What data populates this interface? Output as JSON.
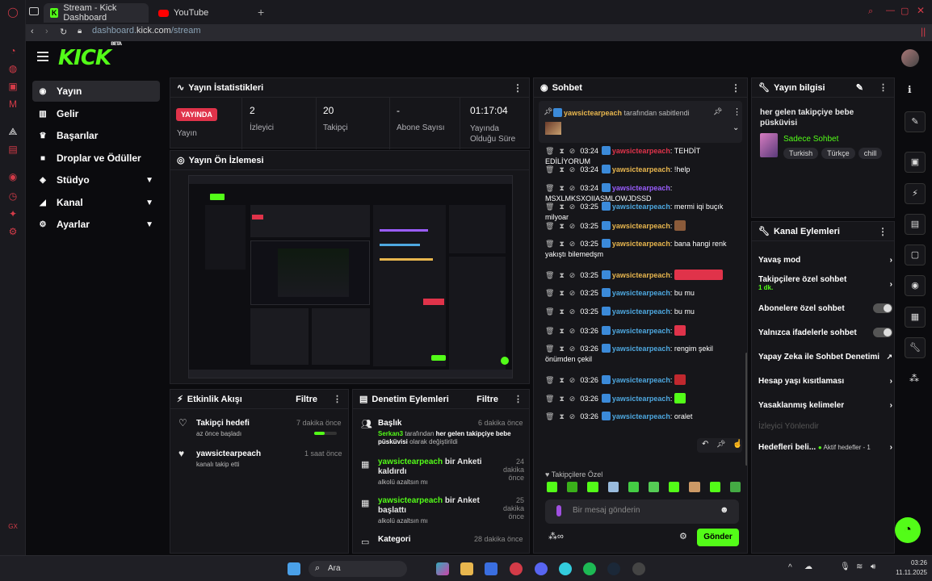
{
  "browser": {
    "tabs": [
      {
        "label": "Stream - Kick Dashboard"
      },
      {
        "label": "YouTube"
      }
    ],
    "address": {
      "prefix": "dashboard.",
      "domain": "kick.com",
      "path": "/stream"
    }
  },
  "header": {
    "logo": "KICK",
    "logo_badge": "BETA"
  },
  "sidebar": {
    "items": [
      {
        "label": "Yayın",
        "icon": "broadcast-icon",
        "active": true
      },
      {
        "label": "Gelir",
        "icon": "chart-icon"
      },
      {
        "label": "Başarılar",
        "icon": "trophy-icon"
      },
      {
        "label": "Droplar ve Ödüller",
        "icon": "gift-icon"
      },
      {
        "label": "Stüdyo",
        "icon": "studio-icon",
        "expandable": true
      },
      {
        "label": "Kanal",
        "icon": "speaker-icon",
        "expandable": true
      },
      {
        "label": "Ayarlar",
        "icon": "gear-icon",
        "expandable": true
      }
    ]
  },
  "stats": {
    "title": "Yayın İstatistikleri",
    "live_badge": "YAYINDA",
    "live_label": "Yayın",
    "items": [
      {
        "value": "2",
        "label": "İzleyici"
      },
      {
        "value": "20",
        "label": "Takipçi"
      },
      {
        "value": "-",
        "label": "Abone Sayısı"
      },
      {
        "value": "01:17:04",
        "label": "Yayında Olduğu Süre"
      }
    ]
  },
  "preview": {
    "title": "Yayın Ön İzlemesi"
  },
  "activity": {
    "title": "Etkinlik Akışı",
    "filter": "Filtre",
    "items": [
      {
        "title": "Takipçi hedefi",
        "sub": "az önce başladı",
        "time": "7 dakika önce",
        "progress": 0.45
      },
      {
        "title": "yawsictearpeach",
        "sub": "kanalı takip etti",
        "time": "1 saat önce"
      }
    ]
  },
  "moderation": {
    "title": "Denetim Eylemleri",
    "filter": "Filtre",
    "items": [
      {
        "title": "Başlık",
        "time": "6 dakika önce",
        "user": "Serkan3",
        "mid": " tarafından ",
        "highlight": "her gelen takipçiye bebe püsküvisi",
        "tail": " olarak değiştirildi"
      },
      {
        "title": "yawsictearpeach",
        "title2": " bir Anketi kaldırdı",
        "time": "24 dakika önce",
        "sub": "alkolü azaltsın mı"
      },
      {
        "title": "yawsictearpeach",
        "title2": " bir Anket başlattı",
        "time": "25 dakika önce",
        "sub": "alkolü azaltsın mı"
      },
      {
        "title": "Kategori",
        "time": "28 dakika önce"
      }
    ]
  },
  "chat": {
    "title": "Sohbet",
    "pinned_user": "yawsictearpeach",
    "pinned_text": " tarafından sabitlendi",
    "messages": [
      {
        "time": "03:24",
        "user": "yawsictearpeach",
        "color": "red",
        "text": ": TEHDİT EDİLİYORUM"
      },
      {
        "time": "03:24",
        "user": "yawsictearpeach",
        "color": "yellow",
        "text": ": !help"
      },
      {
        "time": "03:24",
        "user": "yawsictearpeach",
        "color": "purple",
        "text": ": MSXLMKSXOIIASMLOWJDSSD"
      },
      {
        "time": "03:25",
        "user": "yawsictearpeach",
        "color": "blue",
        "text": ": mermi iqi buçık milyoar"
      },
      {
        "time": "03:25",
        "user": "yawsictearpeach",
        "color": "yellow",
        "text": ":"
      },
      {
        "time": "03:25",
        "user": "yawsictearpeach",
        "color": "yellow",
        "text": ": bana hangi renk yakıştı bilemedşm"
      },
      {
        "time": "03:25",
        "user": "yawsictearpeach",
        "color": "yellow",
        "text": ":"
      },
      {
        "time": "03:25",
        "user": "yawsictearpeach",
        "color": "blue",
        "text": ": bu mu"
      },
      {
        "time": "03:25",
        "user": "yawsictearpeach",
        "color": "blue",
        "text": ": bu mu"
      },
      {
        "time": "03:26",
        "user": "yawsictearpeach",
        "color": "blue",
        "text": ":"
      },
      {
        "time": "03:26",
        "user": "yawsictearpeach",
        "color": "blue",
        "text": ": rengim şekil önümden çekil"
      },
      {
        "time": "03:26",
        "user": "yawsictearpeach",
        "color": "blue",
        "text": ":"
      },
      {
        "time": "03:26",
        "user": "yawsictearpeach",
        "color": "blue",
        "text": ":"
      },
      {
        "time": "03:26",
        "user": "yawsictearpeach",
        "color": "blue",
        "text": ": oralet"
      }
    ],
    "followers_only": "Takipçilere Özel",
    "input_placeholder": "Bir mesaj gönderin",
    "send": "Gönder"
  },
  "stream_info": {
    "title": "Yayın bilgisi",
    "stream_title": "her gelen takipçiye bebe püsküvisi",
    "category": "Sadece Sohbet",
    "tags": [
      "Turkish",
      "Türkçe",
      "chill"
    ]
  },
  "channel_actions": {
    "title": "Kanal Eylemleri",
    "items": [
      {
        "label": "Yavaş mod",
        "kind": "arrow"
      },
      {
        "label": "Takipçilere özel sohbet",
        "sub": "1 dk.",
        "kind": "arrow"
      },
      {
        "label": "Abonelere özel sohbet",
        "kind": "toggle"
      },
      {
        "label": "Yalnızca ifadelerle sohbet",
        "kind": "toggle"
      },
      {
        "label": "Yapay Zeka ile Sohbet Denetimi",
        "kind": "external"
      },
      {
        "label": "Hesap yaşı kısıtlaması",
        "kind": "arrow"
      },
      {
        "label": "Yasaklanmış kelimeler",
        "kind": "arrow"
      },
      {
        "label": "İzleyici Yönlendir",
        "kind": "disabled"
      },
      {
        "label": "Hedefleri beli...",
        "sub": "Aktif hedefler - 1",
        "kind": "arrow"
      }
    ]
  },
  "taskbar": {
    "search": "Ara",
    "time": "03:26",
    "date": "11.11.2025"
  },
  "colors": {
    "accent": "#53fc18",
    "live": "#e0334a",
    "panel": "#16161a"
  }
}
